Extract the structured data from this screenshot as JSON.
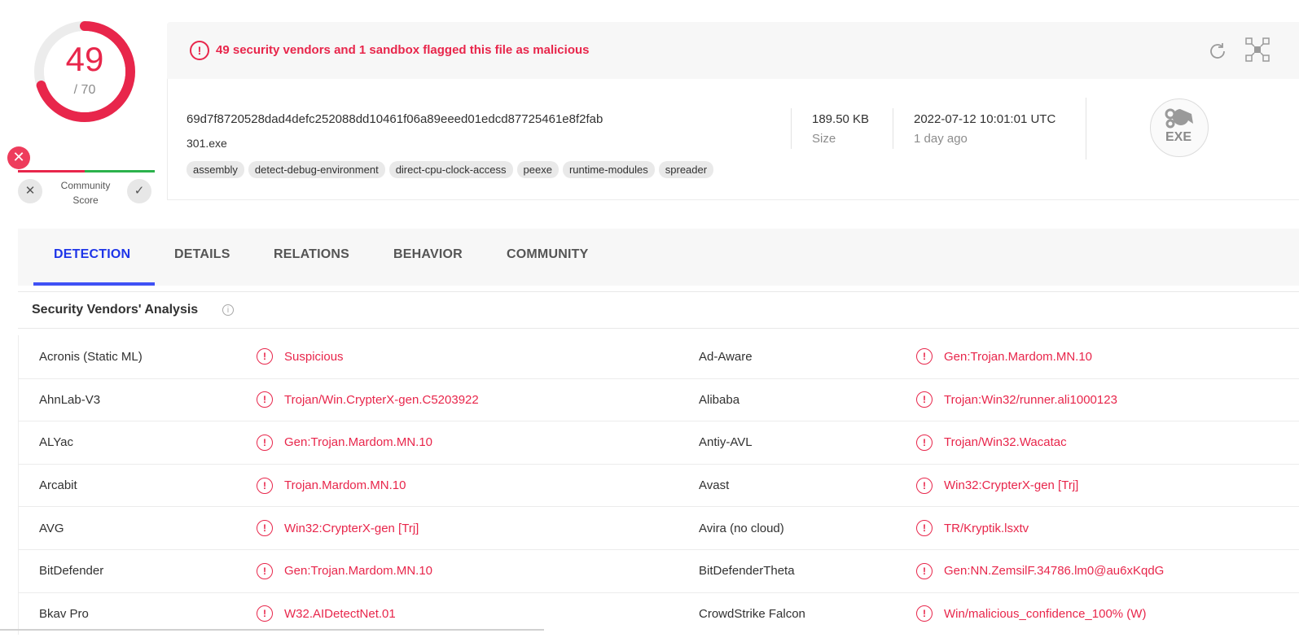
{
  "score": {
    "detections": "49",
    "total": "/ 70"
  },
  "community": {
    "label_line1": "Community",
    "label_line2": "Score",
    "badge": "✕",
    "down_glyph": "✕",
    "up_glyph": "✓"
  },
  "alert": {
    "icon": "!",
    "message": "49 security vendors and 1 sandbox flagged this file as malicious"
  },
  "file": {
    "hash": "69d7f8720528dad4defc252088dd10461f06a89eeed01edcd87725461e8f2fab",
    "name": "301.exe",
    "tags": [
      "assembly",
      "detect-debug-environment",
      "direct-cpu-clock-access",
      "peexe",
      "runtime-modules",
      "spreader"
    ],
    "size_value": "189.50 KB",
    "size_label": "Size",
    "date_value": "2022-07-12 10:01:01 UTC",
    "date_relative": "1 day ago",
    "type_icon_label": "EXE"
  },
  "tabs": [
    "DETECTION",
    "DETAILS",
    "RELATIONS",
    "BEHAVIOR",
    "COMMUNITY"
  ],
  "section": {
    "title": "Security Vendors' Analysis",
    "info_icon": "i"
  },
  "colors": {
    "malicious": "#e8264b",
    "accent": "#3f51f5",
    "community_green": "#2bb24c"
  },
  "vendors": [
    {
      "left_name": "Acronis (Static ML)",
      "left_result": "Suspicious",
      "right_name": "Ad-Aware",
      "right_result": "Gen:Trojan.Mardom.MN.10"
    },
    {
      "left_name": "AhnLab-V3",
      "left_result": "Trojan/Win.CrypterX-gen.C5203922",
      "right_name": "Alibaba",
      "right_result": "Trojan:Win32/runner.ali1000123"
    },
    {
      "left_name": "ALYac",
      "left_result": "Gen:Trojan.Mardom.MN.10",
      "right_name": "Antiy-AVL",
      "right_result": "Trojan/Win32.Wacatac"
    },
    {
      "left_name": "Arcabit",
      "left_result": "Trojan.Mardom.MN.10",
      "right_name": "Avast",
      "right_result": "Win32:CrypterX-gen [Trj]"
    },
    {
      "left_name": "AVG",
      "left_result": "Win32:CrypterX-gen [Trj]",
      "right_name": "Avira (no cloud)",
      "right_result": "TR/Kryptik.lsxtv"
    },
    {
      "left_name": "BitDefender",
      "left_result": "Gen:Trojan.Mardom.MN.10",
      "right_name": "BitDefenderTheta",
      "right_result": "Gen:NN.ZemsilF.34786.lm0@au6xKqdG"
    },
    {
      "left_name": "Bkav Pro",
      "left_result": "W32.AIDetectNet.01",
      "right_name": "CrowdStrike Falcon",
      "right_result": "Win/malicious_confidence_100% (W)"
    }
  ]
}
